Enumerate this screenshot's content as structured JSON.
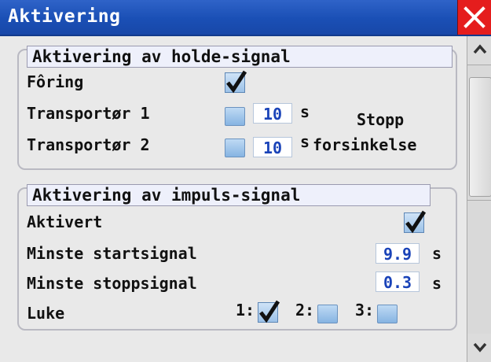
{
  "window": {
    "title": "Aktivering"
  },
  "hold_group": {
    "legend": "Aktivering av holde-signal",
    "foring_label": "Fôring",
    "foring_checked": true,
    "t1_label": "Transportør 1",
    "t1_checked": false,
    "t1_value": "10",
    "t1_unit": "s",
    "t2_label": "Transportør 2",
    "t2_checked": false,
    "t2_value": "10",
    "t2_unit": "s",
    "delay_label_line1": "Stopp",
    "delay_label_line2": "forsinkelse"
  },
  "impulse_group": {
    "legend": "Aktivering av impuls-signal",
    "active_label": "Aktivert",
    "active_checked": true,
    "min_start_label": "Minste startsignal",
    "min_start_value": "9.9",
    "min_start_unit": "s",
    "min_stop_label": "Minste stoppsignal",
    "min_stop_value": "0.3",
    "min_stop_unit": "s",
    "luke_label": "Luke",
    "luke_options": [
      {
        "label": "1:",
        "checked": true
      },
      {
        "label": "2:",
        "checked": false
      },
      {
        "label": "3:",
        "checked": false
      }
    ]
  },
  "colors": {
    "titlebar": "#1a4fb5",
    "close": "#e51d1d",
    "value_text": "#1a43b8"
  },
  "icons": [
    "close-icon",
    "checkmark-icon",
    "scroll-up-icon",
    "scroll-down-icon"
  ]
}
